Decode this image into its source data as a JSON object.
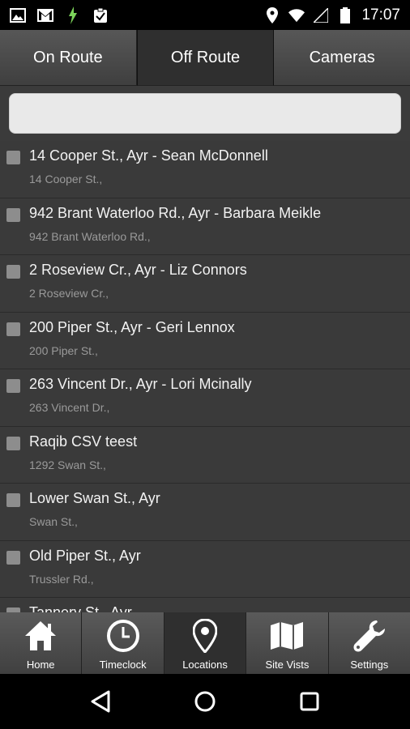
{
  "status_bar": {
    "time": "17:07",
    "left_icons": [
      "image-icon",
      "gmail-icon",
      "battery-bolt-icon",
      "clipboard-check-icon"
    ],
    "right_icons": [
      "location-icon",
      "wifi-icon",
      "signal-icon",
      "battery-icon"
    ]
  },
  "tabs": [
    {
      "label": "On Route",
      "active": false
    },
    {
      "label": "Off Route",
      "active": true
    },
    {
      "label": "Cameras",
      "active": false
    }
  ],
  "search": {
    "value": "",
    "placeholder": ""
  },
  "list": {
    "items": [
      {
        "title": "14 Cooper St., Ayr - Sean McDonnell",
        "subtitle": "14 Cooper St.,"
      },
      {
        "title": "942 Brant Waterloo Rd., Ayr - Barbara Meikle",
        "subtitle": "942 Brant Waterloo Rd.,"
      },
      {
        "title": "2 Roseview Cr., Ayr - Liz Connors",
        "subtitle": "2 Roseview Cr.,"
      },
      {
        "title": "200 Piper St., Ayr - Geri Lennox",
        "subtitle": "200 Piper St.,"
      },
      {
        "title": "263 Vincent Dr., Ayr - Lori Mcinally",
        "subtitle": "263 Vincent Dr.,"
      },
      {
        "title": "Raqib CSV teest",
        "subtitle": "1292 Swan St.,"
      },
      {
        "title": "Lower Swan St., Ayr",
        "subtitle": "Swan St.,"
      },
      {
        "title": "Old Piper St., Ayr",
        "subtitle": "Trussler Rd.,"
      },
      {
        "title": "Tannery St., Ayr",
        "subtitle": ""
      }
    ]
  },
  "toolbar": [
    {
      "label": "Home",
      "icon": "home-icon",
      "active": false
    },
    {
      "label": "Timeclock",
      "icon": "clock-icon",
      "active": false
    },
    {
      "label": "Locations",
      "icon": "map-pin-icon",
      "active": true
    },
    {
      "label": "Site Vists",
      "icon": "map-icon",
      "active": false
    },
    {
      "label": "Settings",
      "icon": "wrench-icon",
      "active": false
    }
  ],
  "navbar": {
    "icons": [
      "back-icon",
      "home-circle-icon",
      "recents-icon"
    ]
  }
}
